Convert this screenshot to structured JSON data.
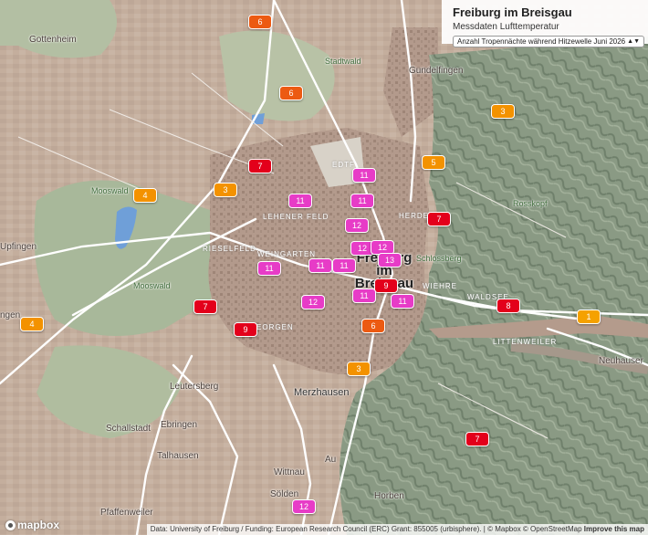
{
  "panel": {
    "title": "Freiburg im Breisgau",
    "subtitle": "Messdaten Lufttemperatur",
    "select_value": "Anzahl Tropennächte während Hitzewelle Juni 2026"
  },
  "colors": {
    "scale_1": "#f5a100",
    "scale_3_4": "#f39200",
    "scale_5_6": "#ec5a12",
    "scale_7_9": "#e3001b",
    "scale_11_13": "#e73cc7"
  },
  "places": [
    {
      "id": "gottenheim",
      "label": "Gottenheim"
    },
    {
      "id": "stadtwald",
      "label": "Stadtwald"
    },
    {
      "id": "gundelfingen",
      "label": "Gundelfingen"
    },
    {
      "id": "edtf",
      "label": "EDTF"
    },
    {
      "id": "mooswald1",
      "label": "Mooswald"
    },
    {
      "id": "mooswald2",
      "label": "Mooswald"
    },
    {
      "id": "umkirch",
      "label": "Upfingen"
    },
    {
      "id": "lehen",
      "label": "LEHENER FELD"
    },
    {
      "id": "rieselfeld",
      "label": "RIESELFELD"
    },
    {
      "id": "weingarten",
      "label": "WEINGARTEN"
    },
    {
      "id": "herdern",
      "label": "HERDERN"
    },
    {
      "id": "wiehre",
      "label": "WIEHRE"
    },
    {
      "id": "waldsee",
      "label": "WALDSEE"
    },
    {
      "id": "littenweiler",
      "label": "LITTENWEILER"
    },
    {
      "id": "schlossberg",
      "label": "Schlossberg"
    },
    {
      "id": "rosskopf",
      "label": "Rosskopf"
    },
    {
      "id": "freiburg",
      "label": "Freiburg im Breisgau"
    },
    {
      "id": "stgeorgen",
      "label": "ST. GEORGEN"
    },
    {
      "id": "gengen",
      "label": "ngen"
    },
    {
      "id": "leutersberg",
      "label": "Leutersberg"
    },
    {
      "id": "merzhausen",
      "label": "Merzhausen"
    },
    {
      "id": "schallstadt",
      "label": "Schallstadt"
    },
    {
      "id": "ebringen",
      "label": "Ebringen"
    },
    {
      "id": "talhausen",
      "label": "Talhausen"
    },
    {
      "id": "au",
      "label": "Au"
    },
    {
      "id": "wittnau",
      "label": "Wittnau"
    },
    {
      "id": "soelden",
      "label": "Sölden"
    },
    {
      "id": "horben",
      "label": "Horben"
    },
    {
      "id": "pfaffenweiler",
      "label": "Pfaffenweiler"
    },
    {
      "id": "neuhauser",
      "label": "Neuhauser"
    }
  ],
  "markers": [
    {
      "value": "6",
      "color": "#ec5a12"
    },
    {
      "value": "6",
      "color": "#ec5a12"
    },
    {
      "value": "3",
      "color": "#f39200"
    },
    {
      "value": "7",
      "color": "#e3001b"
    },
    {
      "value": "5",
      "color": "#f39200"
    },
    {
      "value": "4",
      "color": "#f39200"
    },
    {
      "value": "3",
      "color": "#f39200"
    },
    {
      "value": "11",
      "color": "#e73cc7"
    },
    {
      "value": "11",
      "color": "#e73cc7"
    },
    {
      "value": "11",
      "color": "#e73cc7"
    },
    {
      "value": "7",
      "color": "#e3001b"
    },
    {
      "value": "12",
      "color": "#e73cc7"
    },
    {
      "value": "12",
      "color": "#e73cc7"
    },
    {
      "value": "12",
      "color": "#e73cc7"
    },
    {
      "value": "13",
      "color": "#e73cc7"
    },
    {
      "value": "11",
      "color": "#e73cc7"
    },
    {
      "value": "11",
      "color": "#e73cc7"
    },
    {
      "value": "11",
      "color": "#e73cc7"
    },
    {
      "value": "12",
      "color": "#e73cc7"
    },
    {
      "value": "9",
      "color": "#e3001b"
    },
    {
      "value": "11",
      "color": "#e73cc7"
    },
    {
      "value": "11",
      "color": "#e73cc7"
    },
    {
      "value": "8",
      "color": "#e3001b"
    },
    {
      "value": "1",
      "color": "#f5a100"
    },
    {
      "value": "7",
      "color": "#e3001b"
    },
    {
      "value": "9",
      "color": "#e3001b"
    },
    {
      "value": "6",
      "color": "#ec5a12"
    },
    {
      "value": "4",
      "color": "#f39200"
    },
    {
      "value": "3",
      "color": "#f39200"
    },
    {
      "value": "7",
      "color": "#e3001b"
    },
    {
      "value": "12",
      "color": "#e73cc7"
    }
  ],
  "attribution": {
    "data_text": "Data: University of Freiburg / Funding: European Research Council (ERC) Grant: 855005 (urbisphere).",
    "mapbox": "© Mapbox",
    "osm": "© OpenStreetMap",
    "improve": "Improve this map"
  },
  "logo_text": "mapbox"
}
